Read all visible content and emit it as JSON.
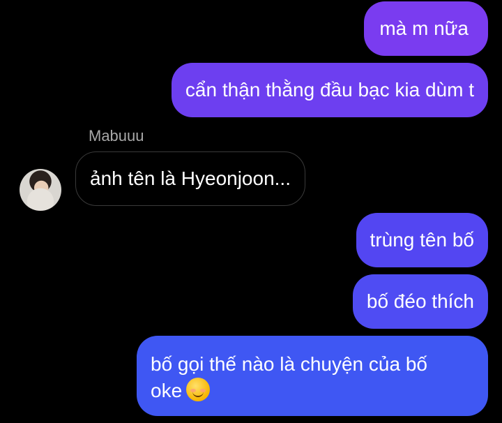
{
  "conversation": {
    "messages": [
      {
        "direction": "outgoing",
        "text": "mà m nữa"
      },
      {
        "direction": "outgoing",
        "text": "cẩn thận thằng đầu bạc kia dùm t"
      },
      {
        "direction": "incoming",
        "sender": "Mabuuu",
        "text": "ảnh tên là Hyeonjoon..."
      },
      {
        "direction": "outgoing",
        "text": "trùng tên bố"
      },
      {
        "direction": "outgoing",
        "text": "bố đéo thích"
      },
      {
        "direction": "outgoing",
        "text_line1": "bố gọi thế nào là chuyện của bố",
        "text_line2": "oke"
      }
    ],
    "emoji": "smiling-face-with-smiling-eyes",
    "colors": {
      "background": "#000000",
      "outgoing_top": "#7a3cf0",
      "outgoing_bottom": "#3f57f3",
      "incoming_border": "#3a3a3a",
      "sender_name": "#a8a8a8"
    }
  }
}
